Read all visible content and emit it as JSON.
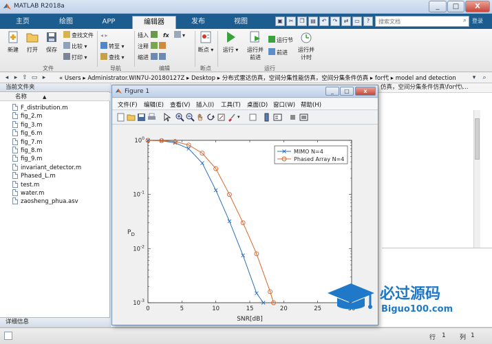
{
  "window": {
    "title": "MATLAB R2018a",
    "buttons": [
      "_",
      "□",
      "X"
    ]
  },
  "ribbon": {
    "tabs": [
      "主页",
      "绘图",
      "APP",
      "编辑器",
      "发布",
      "视图"
    ],
    "active_tab": "编辑器",
    "search_placeholder": "搜索文档",
    "login": "登录",
    "groups": {
      "file": {
        "label": "文件",
        "new": "新建",
        "open": "打开",
        "save": "保存",
        "find_files": "查找文件",
        "compare": "比较",
        "print": "打印"
      },
      "navigate": {
        "label": "导航",
        "goto": "转至",
        "find": "查找"
      },
      "edit": {
        "label": "编辑",
        "insert": "插入",
        "fx": "fx",
        "comment": "注释",
        "indent": "缩进"
      },
      "breakpoints": {
        "label": "断点",
        "breakpoint": "断点"
      },
      "run": {
        "label": "运行",
        "run": "运行",
        "run_advance_1": "运行并",
        "run_advance_2": "前进",
        "run_section": "运行节",
        "advance": "前进",
        "run_time_1": "运行并",
        "run_time_2": "计时"
      }
    }
  },
  "address": {
    "crumbs": "«  Users  ▸  Administrator.WIN7U-20180127Z  ▸  Desktop  ▸  分布式雷达仿真，空间分集性能仿真，空间分集条件仿真  ▸  for代  ▸  model and detection"
  },
  "files": {
    "header": "当前文件夹",
    "column": "名称",
    "sort_arrow": "▲",
    "items": [
      "F_distribution.m",
      "fig_2.m",
      "fig_3.m",
      "fig_6.m",
      "fig_7.m",
      "fig_8.m",
      "fig_9.m",
      "invariant_detector.m",
      "Phased_L.m",
      "test.m",
      "water.m",
      "zaosheng_phua.asv"
    ],
    "details": "详细信息"
  },
  "main": {
    "strip_text": "仿真，空间分集条件仿真\\for代\\..."
  },
  "status": {
    "row_label": "行",
    "row_value": "1",
    "col_label": "列",
    "col_value": "1"
  },
  "figure": {
    "title": "Figure 1",
    "menu": [
      "文件(F)",
      "编辑(E)",
      "查看(V)",
      "插入(I)",
      "工具(T)",
      "桌面(D)",
      "窗口(W)",
      "帮助(H)"
    ]
  },
  "watermark": {
    "text": "必过源码",
    "sub": "Biguo100.com"
  },
  "chart_data": {
    "type": "line",
    "title": "",
    "xlabel": "SNR[dB]",
    "ylabel": "P_D",
    "xlim": [
      0,
      30
    ],
    "ylim": [
      0.001,
      1
    ],
    "yscale": "log",
    "xticks": [
      0,
      5,
      10,
      15,
      20,
      25,
      30
    ],
    "yticks": [
      "10^0",
      "10^-1",
      "10^-2",
      "10^-3"
    ],
    "legend_position": "top-right",
    "series": [
      {
        "name": "MIMO N=4",
        "color": "#2a6ebb",
        "marker": "x",
        "x": [
          0,
          2,
          4,
          6,
          8,
          10,
          12,
          14,
          16,
          17
        ],
        "y": [
          1.0,
          0.98,
          0.9,
          0.7,
          0.38,
          0.12,
          0.032,
          0.0075,
          0.0015,
          0.001
        ]
      },
      {
        "name": "Phased Array N=4",
        "color": "#d9662b",
        "marker": "o",
        "x": [
          0,
          2,
          4,
          6,
          8,
          10,
          12,
          14,
          16,
          18,
          18.5
        ],
        "y": [
          1.0,
          0.99,
          0.95,
          0.82,
          0.58,
          0.3,
          0.1,
          0.03,
          0.008,
          0.0016,
          0.001
        ]
      }
    ]
  }
}
